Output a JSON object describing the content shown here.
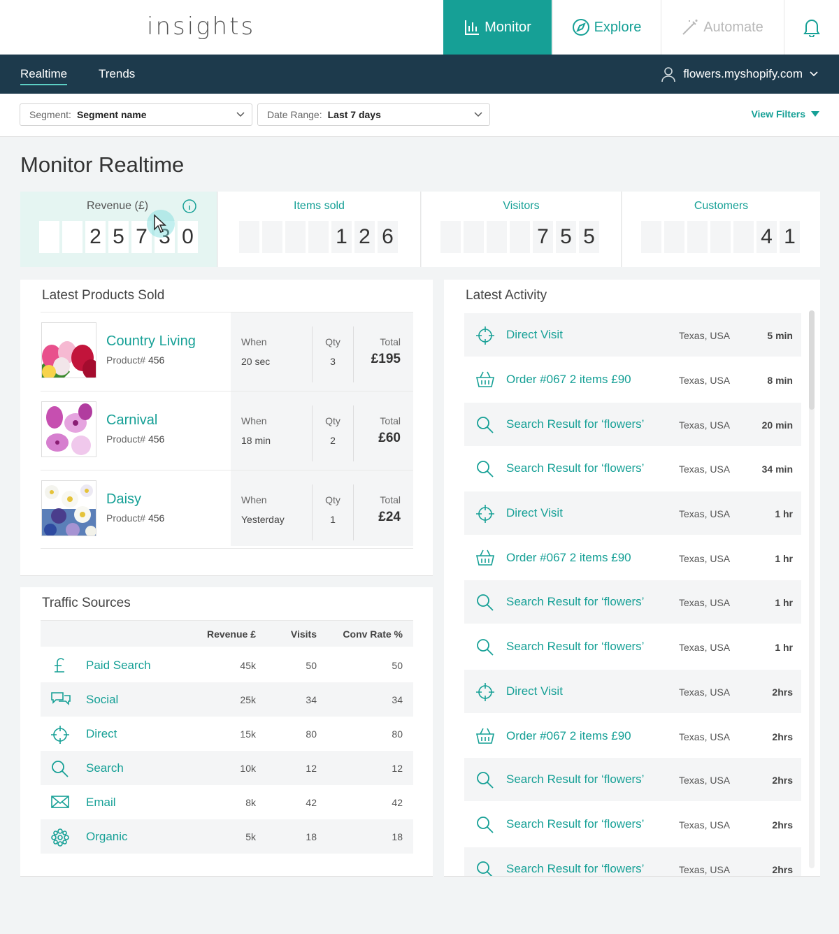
{
  "header": {
    "logo": "insights",
    "nav": [
      {
        "label": "Monitor"
      },
      {
        "label": "Explore"
      },
      {
        "label": "Automate"
      }
    ]
  },
  "subnav": {
    "tabs": [
      "Realtime",
      "Trends"
    ],
    "store": "flowers.myshopify.com"
  },
  "filters": {
    "segment_label": "Segment:",
    "segment_value": "Segment name",
    "date_label": "Date Range:",
    "date_value": "Last 7 days",
    "view_filters": "View Filters"
  },
  "page_title": "Monitor Realtime",
  "kpis": [
    {
      "label": "Revenue (£)",
      "digits": [
        "",
        "",
        "2",
        "5",
        "7",
        "3",
        "0"
      ]
    },
    {
      "label": "Items sold",
      "digits": [
        "",
        "",
        "",
        "",
        "1",
        "2",
        "6"
      ]
    },
    {
      "label": "Visitors",
      "digits": [
        "",
        "",
        "",
        "",
        "7",
        "5",
        "5"
      ]
    },
    {
      "label": "Customers",
      "digits": [
        "",
        "",
        "",
        "",
        "",
        "4",
        "1"
      ]
    }
  ],
  "products": {
    "title": "Latest Products Sold",
    "product_label": "Product#",
    "when_label": "When",
    "qty_label": "Qty",
    "total_label": "Total",
    "items": [
      {
        "name": "Country Living",
        "number": "456",
        "when": "20 sec",
        "qty": "3",
        "total": "£195"
      },
      {
        "name": "Carnival",
        "number": "456",
        "when": "18 min",
        "qty": "2",
        "total": "£60"
      },
      {
        "name": "Daisy",
        "number": "456",
        "when": "Yesterday",
        "qty": "1",
        "total": "£24"
      }
    ]
  },
  "traffic": {
    "title": "Traffic Sources",
    "columns": [
      "Revenue £",
      "Visits",
      "Conv Rate %"
    ],
    "rows": [
      {
        "name": "Paid Search",
        "icon": "pound-icon",
        "revenue": "45k",
        "visits": "50",
        "conv": "50"
      },
      {
        "name": "Social",
        "icon": "chat-bubbles-icon",
        "revenue": "25k",
        "visits": "34",
        "conv": "34"
      },
      {
        "name": "Direct",
        "icon": "crosshair-icon",
        "revenue": "15k",
        "visits": "80",
        "conv": "80"
      },
      {
        "name": "Search",
        "icon": "search-icon",
        "revenue": "10k",
        "visits": "12",
        "conv": "12"
      },
      {
        "name": "Email",
        "icon": "envelope-icon",
        "revenue": "8k",
        "visits": "42",
        "conv": "42"
      },
      {
        "name": "Organic",
        "icon": "flower-icon",
        "revenue": "5k",
        "visits": "18",
        "conv": "18"
      }
    ]
  },
  "activity": {
    "title": "Latest Activity",
    "items": [
      {
        "type": "crosshair-icon",
        "title": "Direct Visit",
        "location": "Texas, USA",
        "time": "5 min"
      },
      {
        "type": "basket-icon",
        "title": "Order #067 2 items £90",
        "location": "Texas, USA",
        "time": "8 min"
      },
      {
        "type": "search-icon",
        "title": "Search Result for ‘flowers’",
        "location": "Texas, USA",
        "time": "20 min"
      },
      {
        "type": "search-icon",
        "title": "Search Result for ‘flowers’",
        "location": "Texas, USA",
        "time": "34 min"
      },
      {
        "type": "crosshair-icon",
        "title": "Direct Visit",
        "location": "Texas, USA",
        "time": "1 hr"
      },
      {
        "type": "basket-icon",
        "title": "Order #067 2 items £90",
        "location": "Texas, USA",
        "time": "1 hr"
      },
      {
        "type": "search-icon",
        "title": "Search Result for ‘flowers’",
        "location": "Texas, USA",
        "time": "1 hr"
      },
      {
        "type": "search-icon",
        "title": "Search Result for ‘flowers’",
        "location": "Texas, USA",
        "time": "1 hr"
      },
      {
        "type": "crosshair-icon",
        "title": "Direct Visit",
        "location": "Texas, USA",
        "time": "2hrs"
      },
      {
        "type": "basket-icon",
        "title": "Order #067 2 items £90",
        "location": "Texas, USA",
        "time": "2hrs"
      },
      {
        "type": "search-icon",
        "title": "Search Result for ‘flowers’",
        "location": "Texas, USA",
        "time": "2hrs"
      },
      {
        "type": "search-icon",
        "title": "Search Result for ‘flowers’",
        "location": "Texas, USA",
        "time": "2hrs"
      },
      {
        "type": "search-icon",
        "title": "Search Result for ‘flowers’",
        "location": "Texas, USA",
        "time": "2hrs"
      }
    ]
  },
  "colors": {
    "accent": "#16a096",
    "navbar": "#1d3a4c",
    "highlight": "#e5f5f2"
  }
}
